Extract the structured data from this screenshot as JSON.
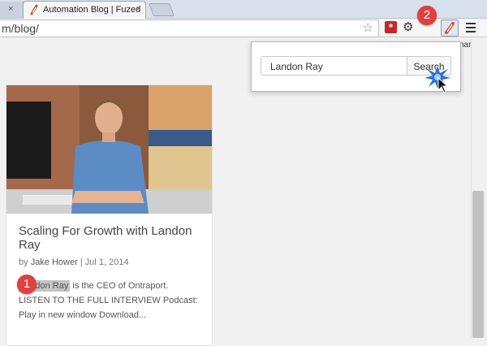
{
  "browser": {
    "tab_title": "Automation Blog | Fuzed",
    "tab_close": "×",
    "url": "m/blog/",
    "bookmarks_label": "narks"
  },
  "popup": {
    "search_value": "Landon Ray",
    "search_button": "Search"
  },
  "badges": {
    "one": "1",
    "two": "2"
  },
  "post": {
    "title": "Scaling For Growth with Landon Ray",
    "by": "by",
    "author": "Jake Hower",
    "separator": "|",
    "date": "Jul 1, 2014",
    "highlight": "Landon Ray",
    "excerpt_rest": " is the CEO of Ontraport. LISTEN TO THE FULL INTERVIEW Podcast: Play in new window Download..."
  },
  "icons": [
    "link-icon",
    "star-icon",
    "asterisk-extension-icon",
    "gear-icon",
    "fuzed-extension-icon",
    "menu-icon",
    "cursor-icon"
  ],
  "colors": {
    "badge": "#e0403f",
    "ext_red": "#c62828"
  }
}
